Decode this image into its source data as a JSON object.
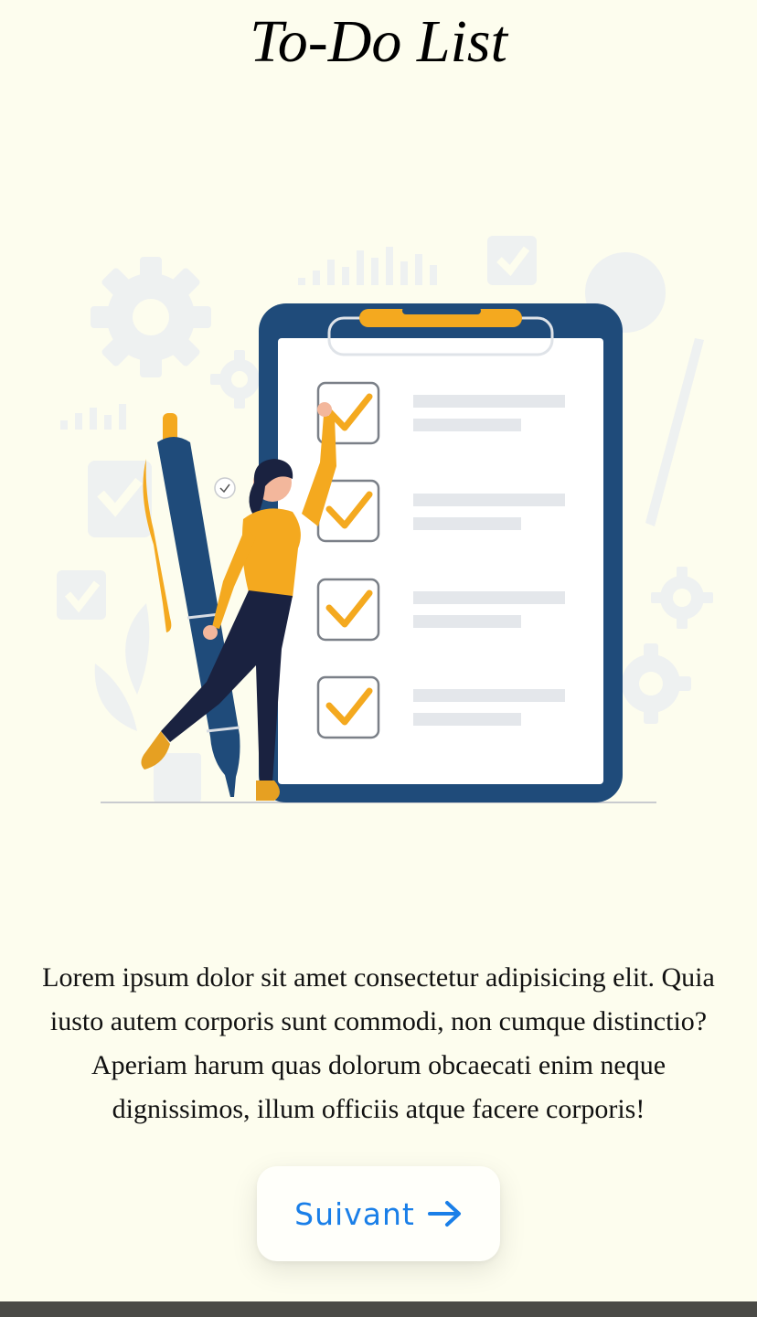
{
  "header": {
    "title": "To-Do List"
  },
  "illustration": {
    "description_icon": "checklist-clipboard-illustration",
    "checked_items": 4
  },
  "content": {
    "description": "Lorem ipsum dolor sit amet consectetur adipisicing elit. Quia iusto autem corporis sunt commodi, non cumque distinctio? Aperiam harum quas dolorum obcaecati enim neque dignissimos, illum officiis atque facere corporis!"
  },
  "actions": {
    "next_label": "Suivant",
    "next_icon": "arrow-right-icon"
  },
  "colors": {
    "background": "#fdfdee",
    "accent": "#1a7fe8",
    "clipboard": "#1f4b7a",
    "highlight": "#f4a91f"
  }
}
